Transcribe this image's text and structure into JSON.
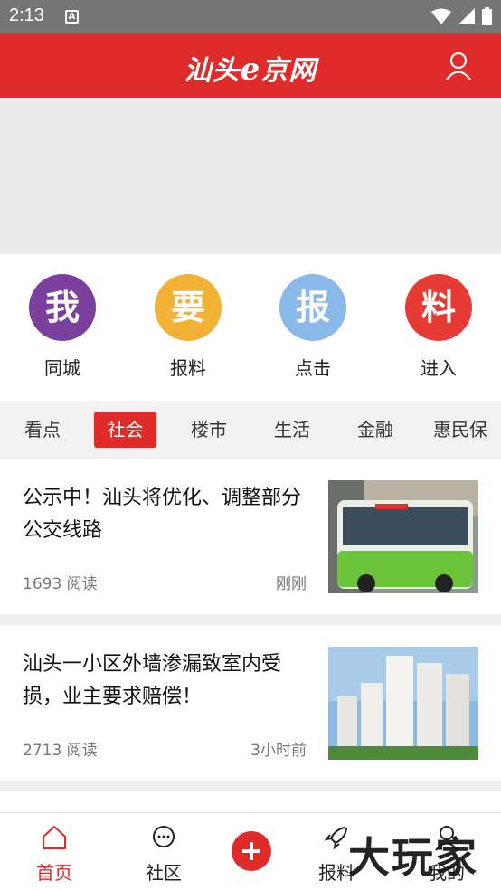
{
  "status_bar": {
    "time": "2:13",
    "notification": "A"
  },
  "header": {
    "logo_main": "汕头",
    "logo_e": "e",
    "logo_tail": "京网"
  },
  "quick_actions": [
    {
      "glyph": "我",
      "label": "同城",
      "color": "#7b3f9e"
    },
    {
      "glyph": "要",
      "label": "报料",
      "color": "#f2b236"
    },
    {
      "glyph": "报",
      "label": "点击",
      "color": "#8ab8e8"
    },
    {
      "glyph": "料",
      "label": "进入",
      "color": "#e63b34"
    }
  ],
  "tabs": [
    "看点",
    "社会",
    "楼市",
    "生活",
    "金融",
    "惠民保"
  ],
  "active_tab": "社会",
  "news": [
    {
      "title": "公示中！汕头将优化、调整部分公交线路",
      "reads": "1693 阅读",
      "time": "刚刚"
    },
    {
      "title": "汕头一小区外墙渗漏致室内受损，业主要求赔偿！",
      "reads": "2713 阅读",
      "time": "3小时前"
    }
  ],
  "bottom_nav": {
    "home": "首页",
    "community": "社区",
    "report": "报料",
    "mine": "我的"
  },
  "watermark": "大玩家",
  "colors": {
    "brand": "#e02b2b",
    "status_bar": "#757575"
  }
}
